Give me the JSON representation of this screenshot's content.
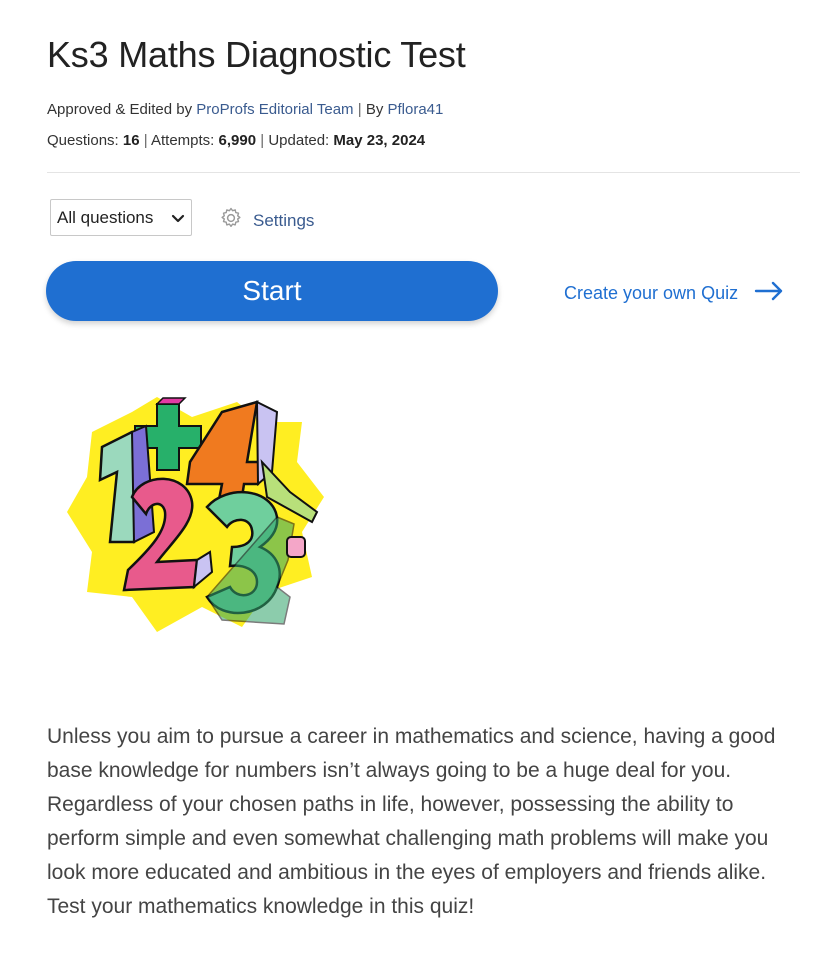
{
  "page": {
    "title": "Ks3 Maths Diagnostic Test"
  },
  "meta": {
    "approved_prefix": "Approved & Edited by",
    "editor": "ProProfs Editorial Team",
    "sep1": "|",
    "by_prefix": "By",
    "author": "Pflora41",
    "questions_label": "Questions:",
    "questions_value": "16",
    "attempts_label": "Attempts:",
    "attempts_value": "6,990",
    "updated_label": "Updated:",
    "updated_value": "May 23, 2024"
  },
  "controls": {
    "filter_selected": "All questions",
    "settings_label": "Settings",
    "start_label": "Start",
    "create_label": "Create your own Quiz"
  },
  "icons": {
    "settings": "gear-icon",
    "arrow": "arrow-right-icon",
    "dropdown": "chevron-down-icon"
  },
  "colors": {
    "primary": "#1f6fd1",
    "link": "#3a5b8f"
  },
  "description": "Unless you aim to pursue a career in mathematics and science, having a good base knowledge for numbers isn’t always going to be a huge deal for you. Regardless of your chosen paths in life, however, possessing the ability to perform simple and even somewhat challenging math problems will make you look more educated and ambitious in the eyes of employers and friends alike. Test your mathematics knowledge in this quiz!"
}
